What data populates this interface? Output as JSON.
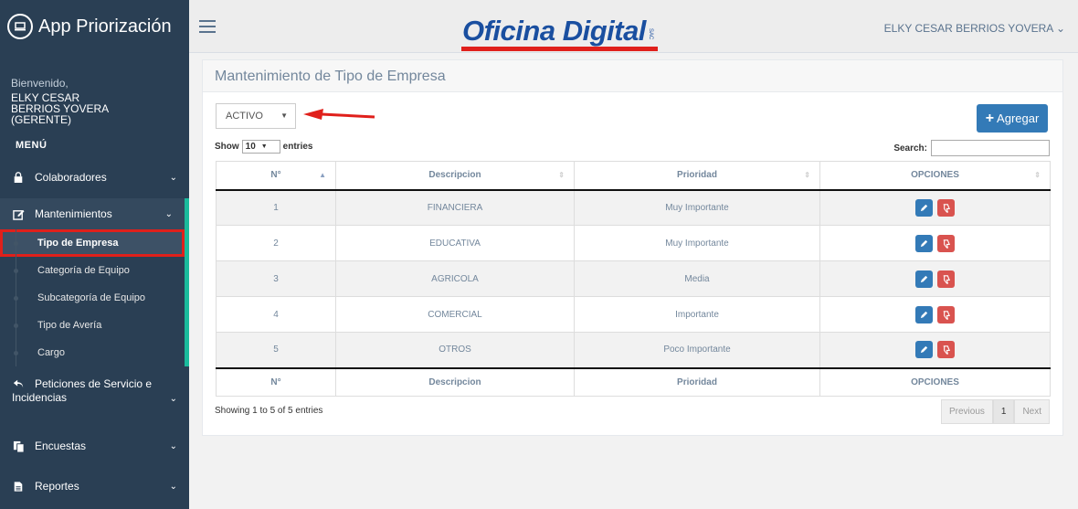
{
  "app": {
    "title": "App Priorización"
  },
  "sidebar": {
    "welcome": "Bienvenido,",
    "user_name": "ELKY CESAR BERRIOS YOVERA (GERENTE)",
    "menu_title": "MENÚ",
    "items": [
      {
        "label": "Colaboradores",
        "icon": "lock-icon"
      },
      {
        "label": "Mantenimientos",
        "icon": "edit-icon"
      },
      {
        "label": "Peticiones de Servicio e",
        "label2": "Incidencias",
        "icon": "reply-all-icon"
      },
      {
        "label": "Encuestas",
        "icon": "clone-icon"
      },
      {
        "label": "Reportes",
        "icon": "file-icon"
      }
    ],
    "subitems": [
      "Tipo de Empresa",
      "Categoría de Equipo",
      "Subcategoría de Equipo",
      "Tipo de Avería",
      "Cargo"
    ]
  },
  "topnav": {
    "logo_text": "Oficina Digital",
    "logo_tag": "SAC",
    "user_menu": "ELKY CESAR BERRIOS YOVERA ⌄"
  },
  "panel": {
    "title": "Mantenimiento de Tipo de Empresa",
    "status_value": "ACTIVO",
    "add_label": "Agregar",
    "show_label": "Show",
    "entries_value": "10",
    "entries_label": "entries",
    "search_label": "Search:",
    "info": "Showing 1 to 5 of 5 entries",
    "pager": {
      "previous": "Previous",
      "page": "1",
      "next": "Next"
    }
  },
  "table": {
    "headers": [
      "N°",
      "Descripcion",
      "Prioridad",
      "OPCIONES"
    ],
    "rows": [
      {
        "n": "1",
        "descripcion": "FINANCIERA",
        "prioridad": "Muy Importante"
      },
      {
        "n": "2",
        "descripcion": "EDUCATIVA",
        "prioridad": "Muy Importante"
      },
      {
        "n": "3",
        "descripcion": "AGRICOLA",
        "prioridad": "Media"
      },
      {
        "n": "4",
        "descripcion": "COMERCIAL",
        "prioridad": "Importante"
      },
      {
        "n": "5",
        "descripcion": "OTROS",
        "prioridad": "Poco Importante"
      }
    ]
  },
  "colors": {
    "sidebar": "#2a3f54",
    "accent": "#1abb9c",
    "primary": "#337ab7",
    "danger": "#d9534f",
    "highlight": "#e0201b"
  }
}
